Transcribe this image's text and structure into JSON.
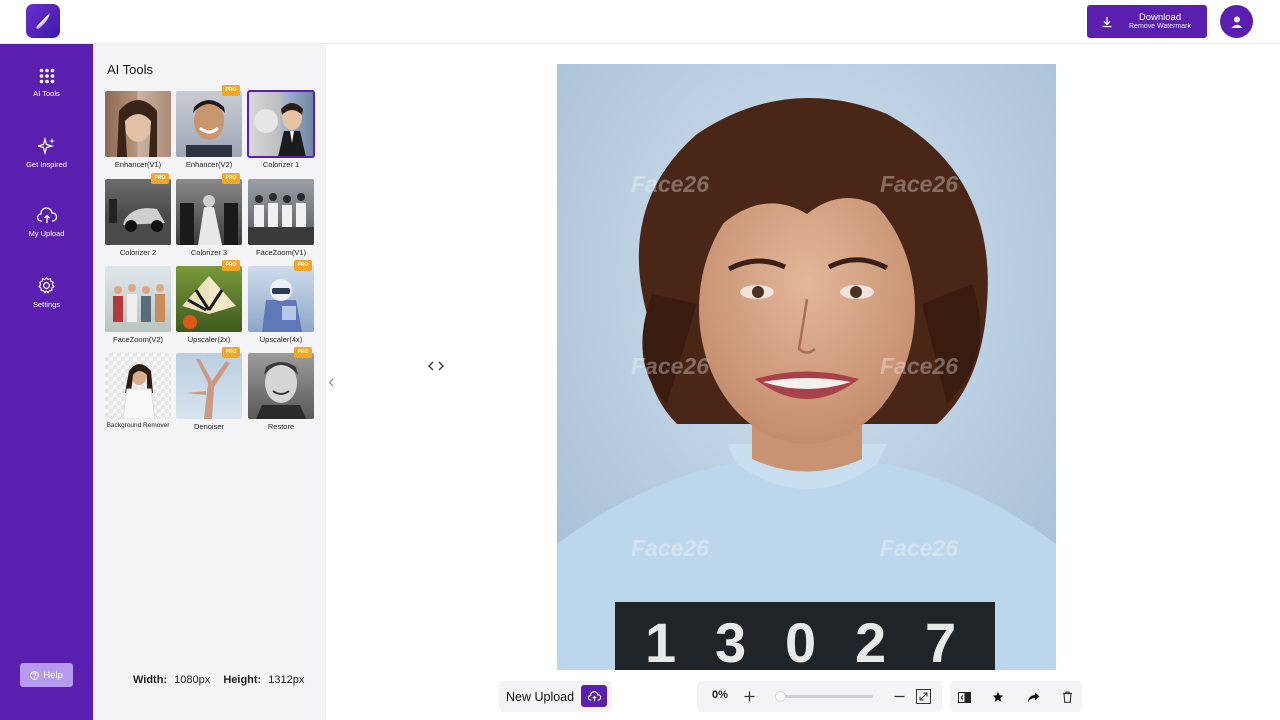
{
  "header": {
    "download": {
      "label": "Download",
      "sublabel": "Remove Watermark"
    }
  },
  "nav": {
    "items": [
      {
        "label": "AI Tools",
        "icon": "grid-icon"
      },
      {
        "label": "Get Inspired",
        "icon": "sparkle-icon"
      },
      {
        "label": "My Upload",
        "icon": "cloud-upload-icon"
      },
      {
        "label": "Settings",
        "icon": "gear-icon"
      }
    ],
    "help_label": "Help"
  },
  "panel": {
    "title": "AI Tools",
    "tools": [
      {
        "label": "Enhancer(V1)",
        "pro": false,
        "selected": false
      },
      {
        "label": "Enhancer(V2)",
        "pro": true,
        "selected": false
      },
      {
        "label": "Colorizer 1",
        "pro": false,
        "selected": true
      },
      {
        "label": "Colorizer 2",
        "pro": true,
        "selected": false
      },
      {
        "label": "Colorizer 3",
        "pro": true,
        "selected": false
      },
      {
        "label": "FaceZoom(V1)",
        "pro": false,
        "selected": false
      },
      {
        "label": "FaceZoom(V2)",
        "pro": false,
        "selected": false
      },
      {
        "label": "Upscaler(2x)",
        "pro": true,
        "selected": false
      },
      {
        "label": "Upscaler(4x)",
        "pro": true,
        "selected": false
      },
      {
        "label": "Background Remover",
        "pro": false,
        "selected": false
      },
      {
        "label": "Denoiser",
        "pro": true,
        "selected": false
      },
      {
        "label": "Restore",
        "pro": true,
        "selected": false
      }
    ],
    "pro_badge": "PRO",
    "width_label": "Width:",
    "width_value": "1080px",
    "height_label": "Height:",
    "height_value": "1312px"
  },
  "canvas": {
    "watermark": "Face26",
    "sign_number": "13027"
  },
  "toolbar": {
    "new_upload": "New Upload",
    "zoom": "0%",
    "zoom_fraction": 0.0
  },
  "colors": {
    "brand": "#5b1fb0",
    "pro": "#f5a623",
    "panel_bg": "#f4f4f6"
  }
}
